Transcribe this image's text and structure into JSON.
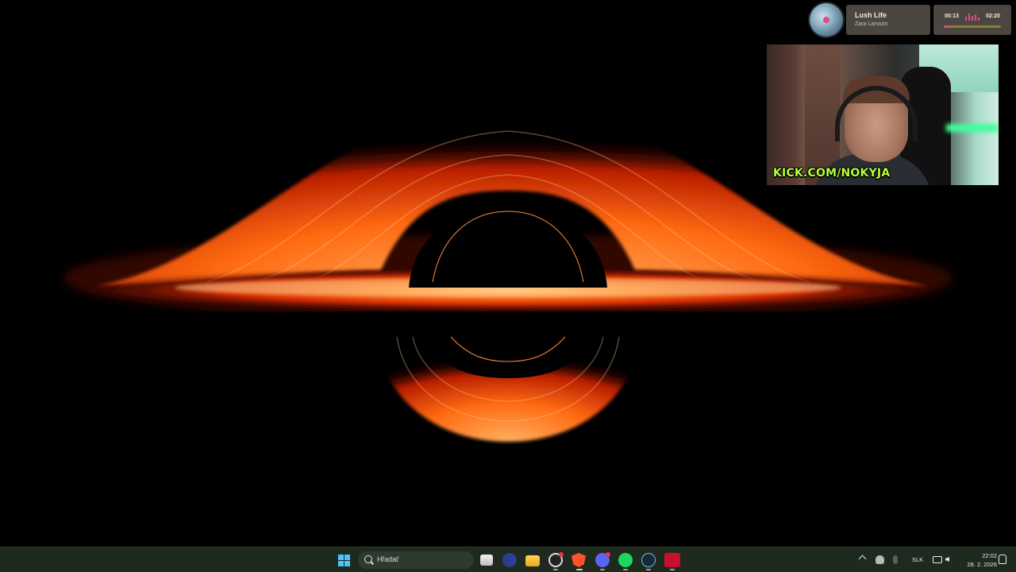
{
  "wallpaper": {
    "subject": "black-hole-accretion-disk",
    "colors": {
      "bright": "#ffb060",
      "mid": "#ff5a10",
      "dark": "#8a1500"
    }
  },
  "now_playing": {
    "title": "Lush Life",
    "artist": "Zara Larsson",
    "current_time": "00:13",
    "duration": "02:20",
    "progress": 0.09,
    "accent_color": "#e24a8a"
  },
  "webcam": {
    "overlay_text": "KICK.COM/NOKYJA",
    "overlay_color": "#b6ff3a"
  },
  "taskbar": {
    "search_placeholder": "Hľadať",
    "apps": [
      "task-view",
      "obs-studio",
      "file-explorer",
      "chrome",
      "brave",
      "discord",
      "spotify",
      "steam",
      "voicemeeter"
    ],
    "tray": {
      "language": "SLK",
      "time": "22:02",
      "date": "28. 2. 2026"
    }
  }
}
